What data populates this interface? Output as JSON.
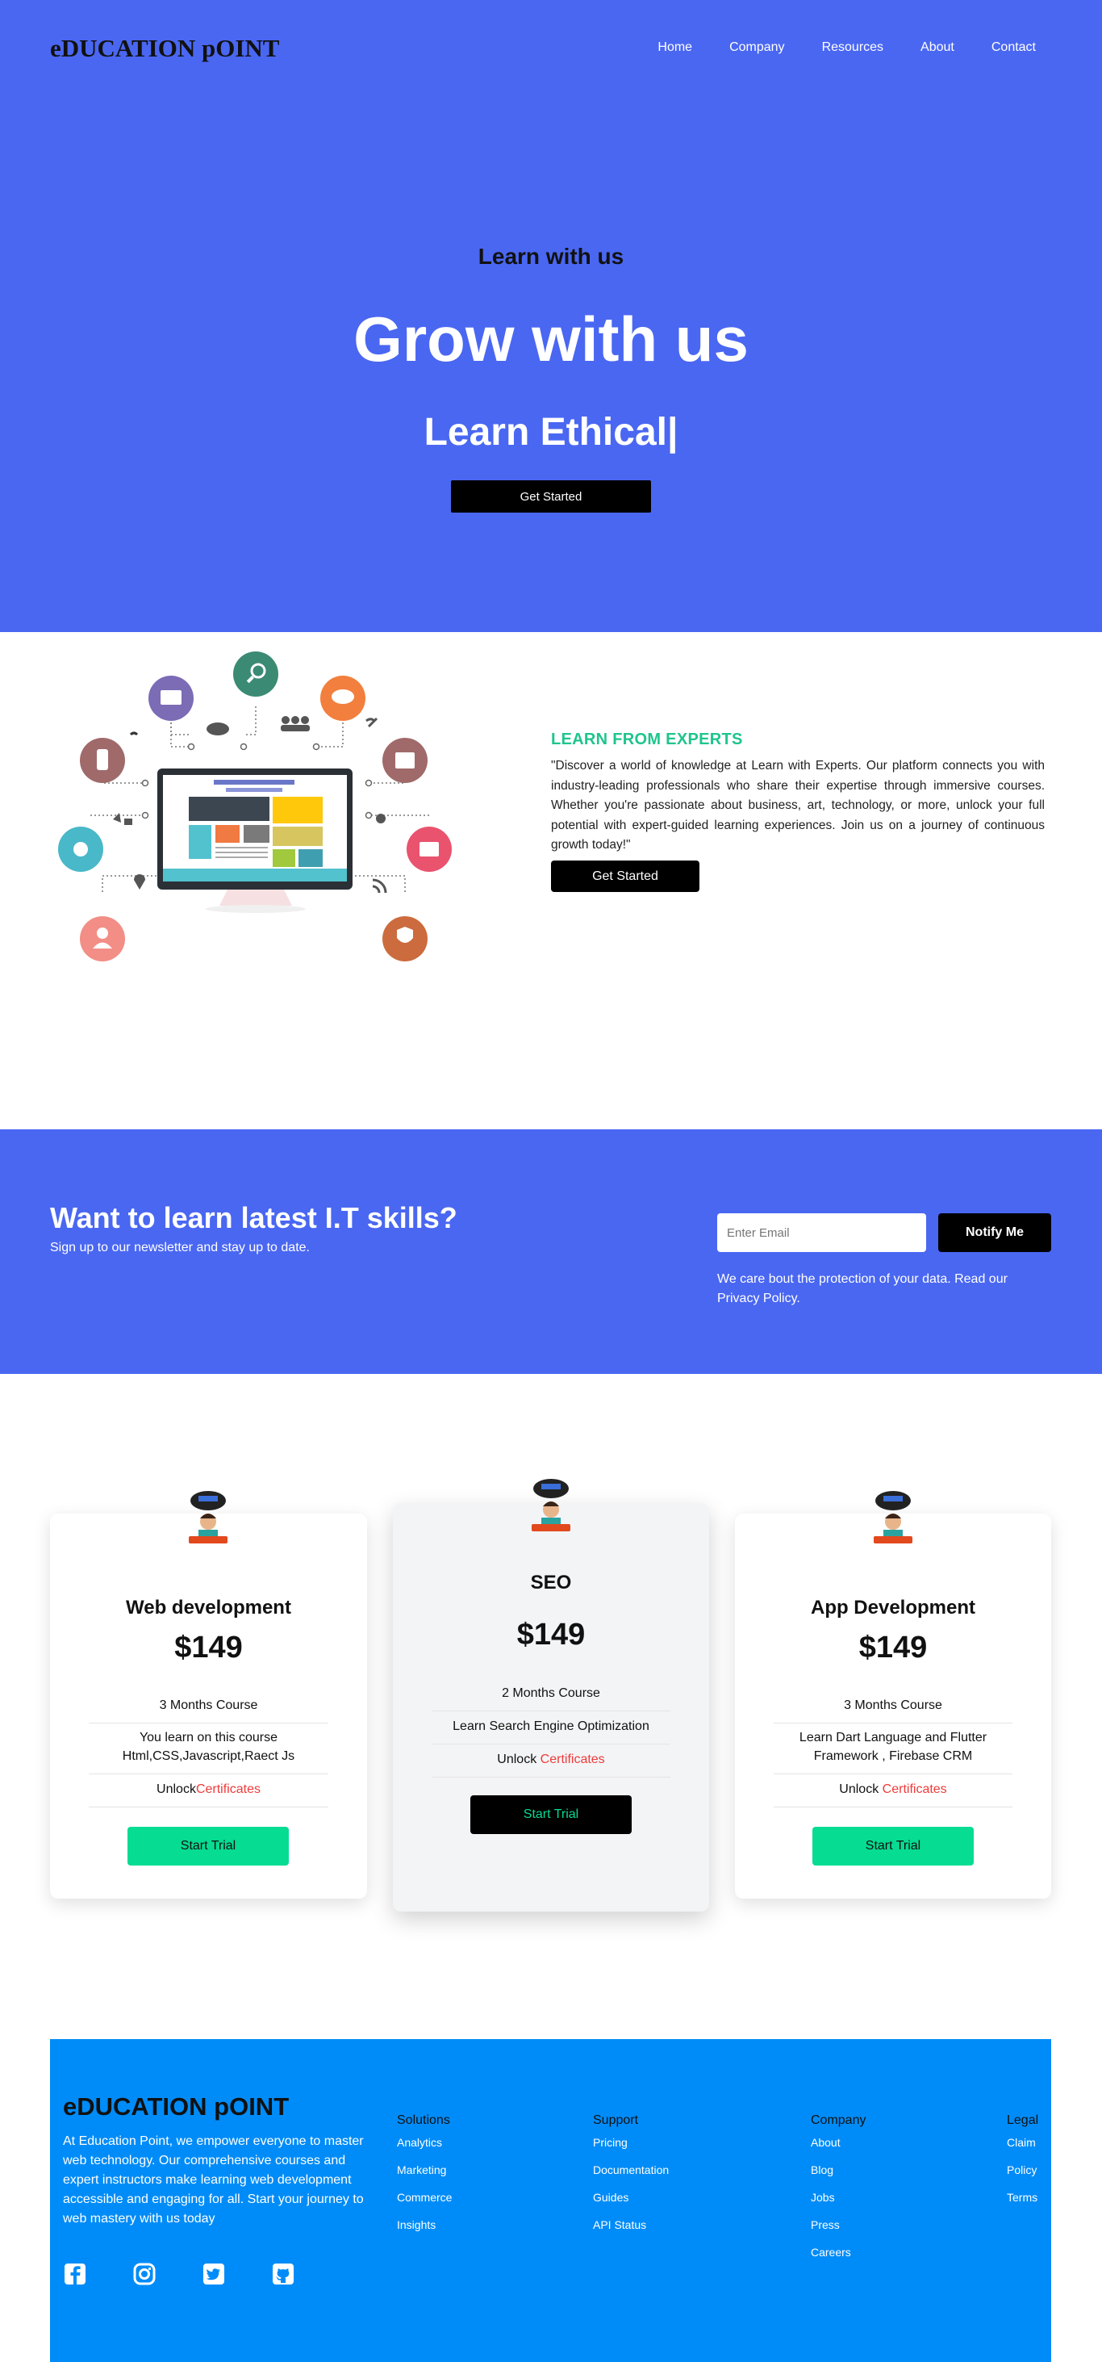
{
  "brand": {
    "logo": "eDUCATION pOINT"
  },
  "nav": {
    "items": [
      "Home",
      "Company",
      "Resources",
      "About",
      "Contact"
    ]
  },
  "hero": {
    "subtitle": "Learn with us",
    "title": "Grow with us",
    "typed": "Learn Ethical|",
    "cta": "Get Started",
    "bg": "#4a67f2"
  },
  "experts": {
    "heading": "LEARN FROM EXPERTS",
    "body": "\"Discover a world of knowledge at Learn with Experts. Our platform connects you with industry-leading professionals who share their expertise through immersive courses. Whether you're passionate about business, art, technology, or more, unlock your full potential with expert-guided learning experiences. Join us on a journey of continuous growth today!\"",
    "cta": "Get Started",
    "heading_color": "#1ec58c"
  },
  "newsletter": {
    "heading": "Want to learn latest I.T skills?",
    "subheading": "Sign up to our newsletter and stay up to date.",
    "email_placeholder": "Enter Email",
    "button": "Notify Me",
    "note": "We care bout the protection of your data. Read our Privacy Policy."
  },
  "pricing": [
    {
      "title": "Web development",
      "price": "$149",
      "duration": "3 Months Course",
      "feature": "You learn on this course Html,CSS,Javascript,Raect Js",
      "unlock": "Unlock",
      "unlock_highlight": "Certificates",
      "cta": "Start Trial"
    },
    {
      "title": "SEO",
      "price": "$149",
      "duration": "2 Months Course",
      "feature": "Learn Search Engine Optimization",
      "unlock": "Unlock ",
      "unlock_highlight": "Certificates",
      "cta": "Start Trial"
    },
    {
      "title": "App Development",
      "price": "$149",
      "duration": "3 Months Course",
      "feature": "Learn Dart Language and Flutter Framework , Firebase CRM",
      "unlock": "Unlock ",
      "unlock_highlight": "Certificates",
      "cta": "Start Trial"
    }
  ],
  "footer": {
    "logo": "eDUCATION pOINT",
    "about": "At Education Point, we empower everyone to master web technology. Our comprehensive courses and expert instructors make learning web development accessible and engaging for all. Start your journey to web mastery with us today",
    "columns": [
      {
        "title": "Solutions",
        "links": [
          "Analytics",
          "Marketing",
          "Commerce",
          "Insights"
        ]
      },
      {
        "title": "Support",
        "links": [
          "Pricing",
          "Documentation",
          "Guides",
          "API Status"
        ]
      },
      {
        "title": "Company",
        "links": [
          "About",
          "Blog",
          "Jobs",
          "Press",
          "Careers"
        ]
      },
      {
        "title": "Legal",
        "links": [
          "Claim",
          "Policy",
          "Terms"
        ]
      }
    ],
    "social": [
      "facebook-icon",
      "instagram-icon",
      "twitter-icon",
      "github-icon"
    ],
    "bg": "#008cf8"
  }
}
